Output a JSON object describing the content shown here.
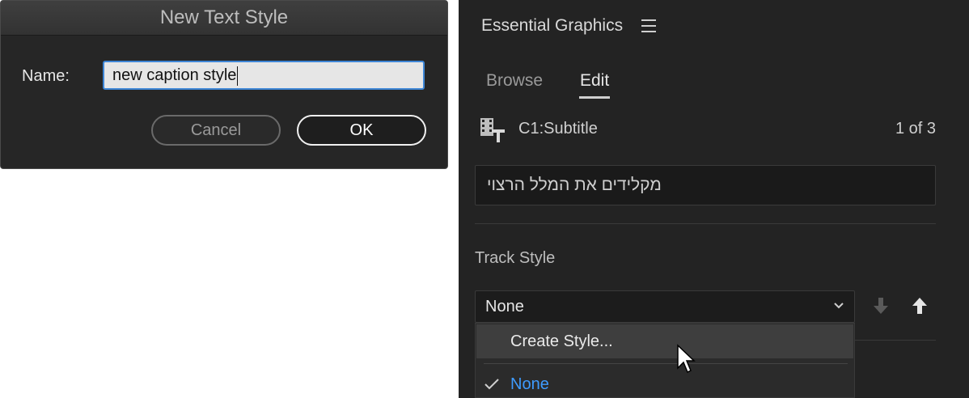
{
  "dialog": {
    "title": "New Text Style",
    "name_label": "Name:",
    "name_value": "new caption style",
    "cancel_label": "Cancel",
    "ok_label": "OK"
  },
  "panel": {
    "title": "Essential Graphics",
    "menu_icon": "hamburger-menu-icon",
    "tabs": [
      {
        "label": "Browse",
        "active": false
      },
      {
        "label": "Edit",
        "active": true
      }
    ],
    "clip": {
      "icon": "caption-clip-icon",
      "name": "C1:Subtitle",
      "count": "1 of 3"
    },
    "caption_text": "מקלידים את המלל הרצוי",
    "track_style_label": "Track Style",
    "track_style_value": "None",
    "dropdown": {
      "items": [
        {
          "label": "Create Style...",
          "highlighted": true
        },
        {
          "label": "None",
          "selected": true
        }
      ]
    }
  },
  "colors": {
    "accent_blue": "#3e86d6",
    "selected_text": "#3e9bff",
    "panel_bg": "#232323"
  }
}
